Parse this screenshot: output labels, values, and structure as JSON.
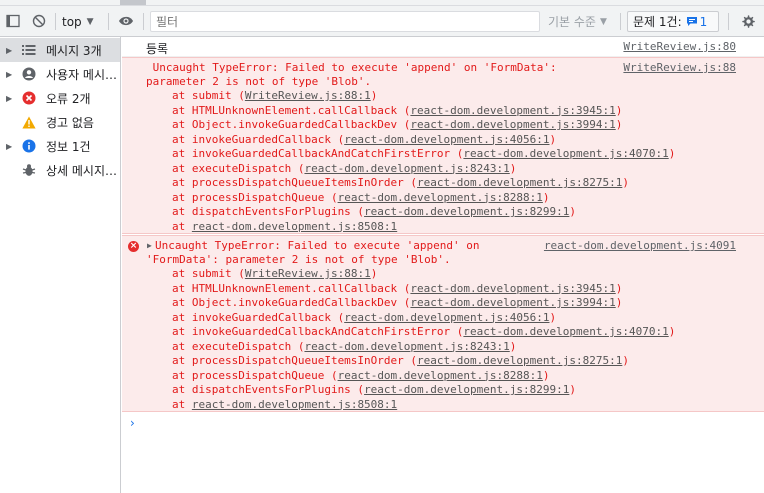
{
  "toolbar": {
    "context": "top",
    "filter_placeholder": "필터",
    "levels_label": "기본 수준",
    "issues_label": "문제 1건:",
    "issues_count": "1"
  },
  "sidebar": {
    "items": [
      {
        "label": "메시지 3개",
        "icon": "list-icon"
      },
      {
        "label": "사용자 메시지 없음",
        "icon": "user-icon"
      },
      {
        "label": "오류 2개",
        "icon": "error-icon"
      },
      {
        "label": "경고 없음",
        "icon": "warning-icon"
      },
      {
        "label": "정보 1건",
        "icon": "info-icon"
      },
      {
        "label": "상세 메시지 없음",
        "icon": "bug-icon"
      }
    ]
  },
  "console": {
    "log_message": {
      "text": "등록",
      "source": "WriteReview.js:80"
    },
    "errors": [
      {
        "source": "WriteReview.js:88",
        "lines": [
          " Uncaught TypeError: Failed to execute 'append' on 'FormData':",
          "parameter 2 is not of type 'Blob'."
        ],
        "stack": [
          {
            "fn": "at submit (",
            "link": "WriteReview.js:88:1",
            "end": ")"
          },
          {
            "fn": "at HTMLUnknownElement.callCallback (",
            "link": "react-dom.development.js:3945:1",
            "end": ")"
          },
          {
            "fn": "at Object.invokeGuardedCallbackDev (",
            "link": "react-dom.development.js:3994:1",
            "end": ")"
          },
          {
            "fn": "at invokeGuardedCallback (",
            "link": "react-dom.development.js:4056:1",
            "end": ")"
          },
          {
            "fn": "at invokeGuardedCallbackAndCatchFirstError (",
            "link": "react-dom.development.js:4070:1",
            "end": ")"
          },
          {
            "fn": "at executeDispatch (",
            "link": "react-dom.development.js:8243:1",
            "end": ")"
          },
          {
            "fn": "at processDispatchQueueItemsInOrder (",
            "link": "react-dom.development.js:8275:1",
            "end": ")"
          },
          {
            "fn": "at processDispatchQueue (",
            "link": "react-dom.development.js:8288:1",
            "end": ")"
          },
          {
            "fn": "at dispatchEventsForPlugins (",
            "link": "react-dom.development.js:8299:1",
            "end": ")"
          },
          {
            "fn": "at ",
            "link": "react-dom.development.js:8508:1",
            "end": ""
          }
        ]
      },
      {
        "source": "react-dom.development.js:4091",
        "lines": [
          "Uncaught TypeError: Failed to execute 'append' on",
          "'FormData': parameter 2 is not of type 'Blob'."
        ],
        "stack": [
          {
            "fn": "at submit (",
            "link": "WriteReview.js:88:1",
            "end": ")"
          },
          {
            "fn": "at HTMLUnknownElement.callCallback (",
            "link": "react-dom.development.js:3945:1",
            "end": ")"
          },
          {
            "fn": "at Object.invokeGuardedCallbackDev (",
            "link": "react-dom.development.js:3994:1",
            "end": ")"
          },
          {
            "fn": "at invokeGuardedCallback (",
            "link": "react-dom.development.js:4056:1",
            "end": ")"
          },
          {
            "fn": "at invokeGuardedCallbackAndCatchFirstError (",
            "link": "react-dom.development.js:4070:1",
            "end": ")"
          },
          {
            "fn": "at executeDispatch (",
            "link": "react-dom.development.js:8243:1",
            "end": ")"
          },
          {
            "fn": "at processDispatchQueueItemsInOrder (",
            "link": "react-dom.development.js:8275:1",
            "end": ")"
          },
          {
            "fn": "at processDispatchQueue (",
            "link": "react-dom.development.js:8288:1",
            "end": ")"
          },
          {
            "fn": "at dispatchEventsForPlugins (",
            "link": "react-dom.development.js:8299:1",
            "end": ")"
          },
          {
            "fn": "at ",
            "link": "react-dom.development.js:8508:1",
            "end": ""
          }
        ]
      }
    ],
    "prompt_symbol": "›"
  },
  "colors": {
    "error": "#e21a1a",
    "error_bg": "#fcebeb",
    "accent": "#1a73e8"
  }
}
